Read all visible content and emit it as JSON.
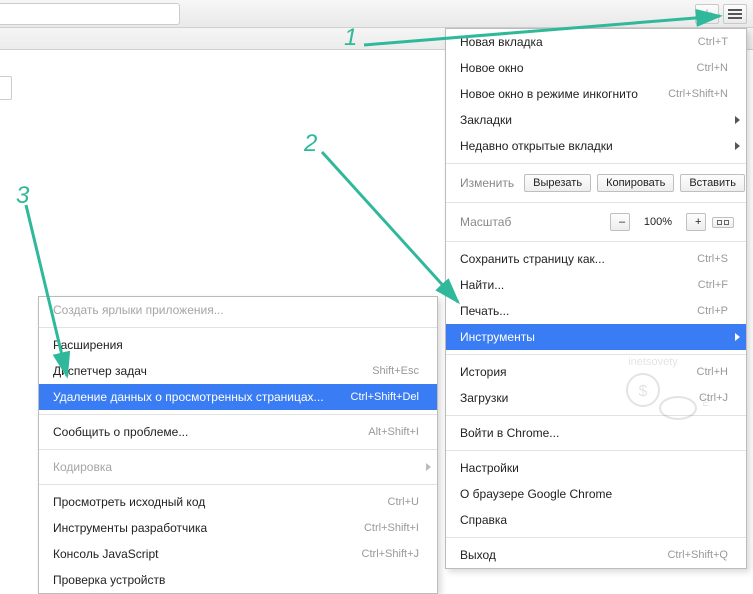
{
  "toolbar": {
    "star_icon": "star-icon",
    "menu_icon": "menu-icon"
  },
  "annotation": {
    "n1": "1",
    "n2": "2",
    "n3": "3"
  },
  "menu": {
    "new_tab": {
      "label": "Новая вкладка",
      "shortcut": "Ctrl+T"
    },
    "new_window": {
      "label": "Новое окно",
      "shortcut": "Ctrl+N"
    },
    "incognito": {
      "label": "Новое окно в режиме инкогнито",
      "shortcut": "Ctrl+Shift+N"
    },
    "bookmarks": {
      "label": "Закладки"
    },
    "recent_tabs": {
      "label": "Недавно открытые вкладки"
    },
    "edit_row": {
      "lead": "Изменить",
      "cut": "Вырезать",
      "copy": "Копировать",
      "paste": "Вставить"
    },
    "zoom_row": {
      "lead": "Масштаб",
      "minus": "–",
      "value": "100%",
      "plus": "+"
    },
    "save_page": {
      "label": "Сохранить страницу как...",
      "shortcut": "Ctrl+S"
    },
    "find": {
      "label": "Найти...",
      "shortcut": "Ctrl+F"
    },
    "print": {
      "label": "Печать...",
      "shortcut": "Ctrl+P"
    },
    "tools": {
      "label": "Инструменты"
    },
    "history": {
      "label": "История",
      "shortcut": "Ctrl+H"
    },
    "downloads": {
      "label": "Загрузки",
      "shortcut": "Ctrl+J"
    },
    "signin": {
      "label": "Войти в Chrome..."
    },
    "settings": {
      "label": "Настройки"
    },
    "about": {
      "label": "О браузере Google Chrome"
    },
    "help": {
      "label": "Справка"
    },
    "exit": {
      "label": "Выход",
      "shortcut": "Ctrl+Shift+Q"
    }
  },
  "submenu": {
    "create_shortcuts": {
      "label": "Создать ярлыки приложения..."
    },
    "extensions": {
      "label": "Расширения"
    },
    "task_manager": {
      "label": "Диспетчер задач",
      "shortcut": "Shift+Esc"
    },
    "clear_browsing": {
      "label": "Удаление данных о просмотренных страницах...",
      "shortcut": "Ctrl+Shift+Del"
    },
    "report_issue": {
      "label": "Сообщить о проблеме...",
      "shortcut": "Alt+Shift+I"
    },
    "encoding": {
      "label": "Кодировка"
    },
    "view_source": {
      "label": "Просмотреть исходный код",
      "shortcut": "Ctrl+U"
    },
    "dev_tools": {
      "label": "Инструменты разработчика",
      "shortcut": "Ctrl+Shift+I"
    },
    "js_console": {
      "label": "Консоль JavaScript",
      "shortcut": "Ctrl+Shift+J"
    },
    "inspect_devices": {
      "label": "Проверка устройств"
    }
  },
  "watermark": "inetsovety.ru"
}
